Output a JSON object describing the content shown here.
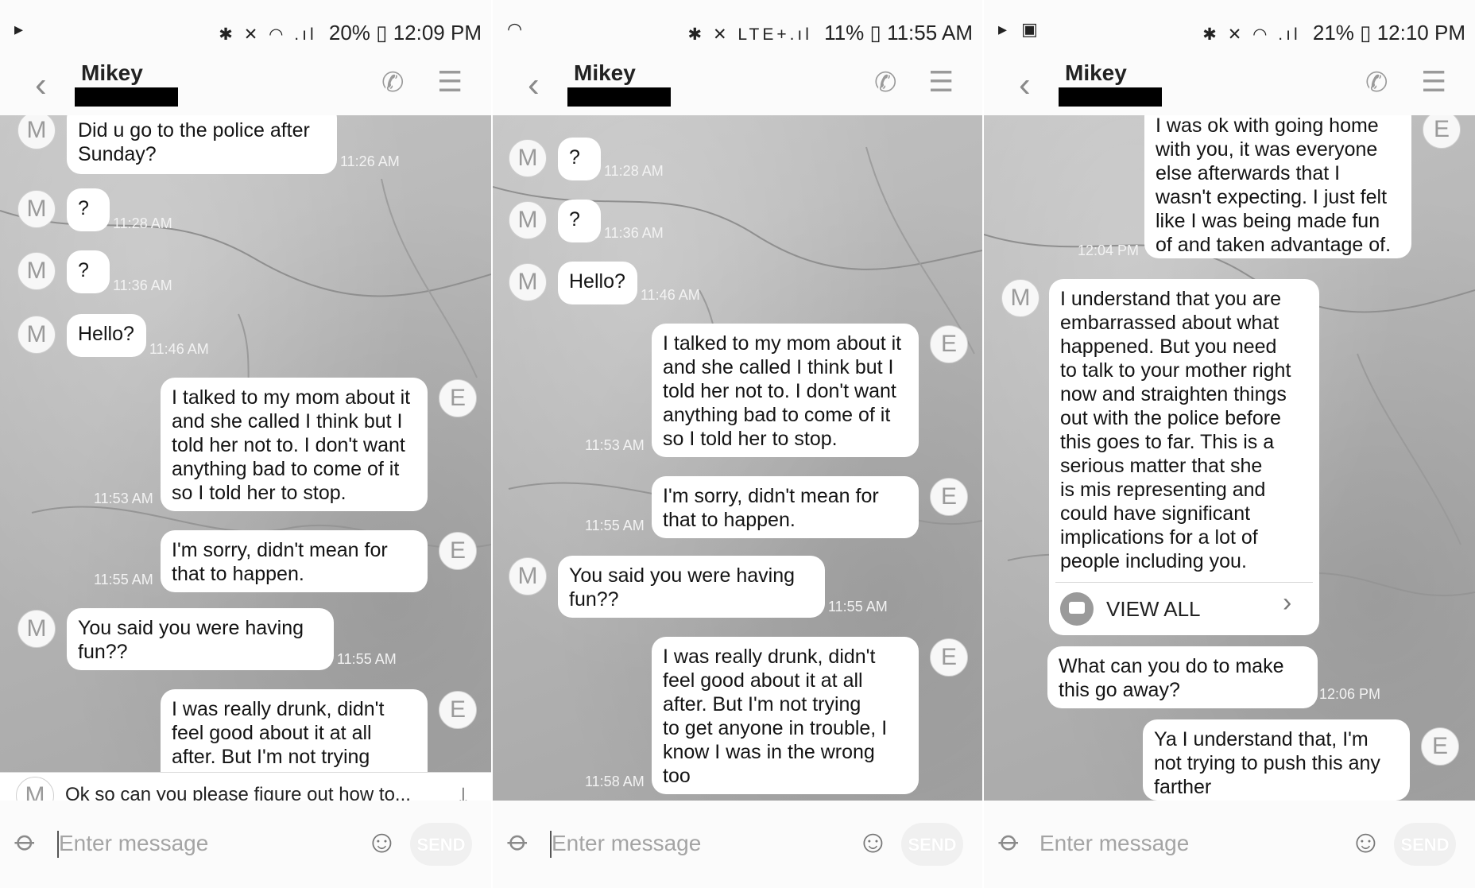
{
  "screens": [
    {
      "status": {
        "left_icons": "▸",
        "right_icons": "✱ ✕ ◠ .ıl",
        "battery": "20%",
        "time": "12:09 PM"
      },
      "contact": "Mikey",
      "messages": [
        {
          "from": "M",
          "text": "Did u go to the police after\nSunday?",
          "time": "11:26 AM"
        },
        {
          "from": "M",
          "text": "?",
          "time": "11:28 AM"
        },
        {
          "from": "M",
          "text": "?",
          "time": "11:36 AM"
        },
        {
          "from": "M",
          "text": "Hello?",
          "time": "11:46 AM"
        },
        {
          "from": "E",
          "text": "I talked to my mom about it\nand she called I think but I\ntold her not to. I don't want\nanything bad to come of it\nso I told her to stop.",
          "time": "11:53 AM"
        },
        {
          "from": "E",
          "text": "I'm sorry, didn't mean for\nthat to happen.",
          "time": "11:55 AM"
        },
        {
          "from": "M",
          "text": "You said you were having\nfun??",
          "time": "11:55 AM"
        },
        {
          "from": "E",
          "text": "I was really drunk, didn't\nfeel good about it at all\nafter. But I'm not trying",
          "time": ""
        }
      ],
      "preview": {
        "avatar": "M",
        "text": "Ok so can you please figure out  how to..."
      },
      "input_placeholder": "Enter message",
      "send_label": "SEND"
    },
    {
      "status": {
        "left_icons": "◠",
        "right_icons": "✱ ✕ LTE+.ıl",
        "battery": "11%",
        "time": "11:55 AM"
      },
      "contact": "Mikey",
      "messages": [
        {
          "from": "M",
          "text": "?",
          "time": "11:28 AM"
        },
        {
          "from": "M",
          "text": "?",
          "time": "11:36 AM"
        },
        {
          "from": "M",
          "text": "Hello?",
          "time": "11:46 AM"
        },
        {
          "from": "E",
          "text": "I talked to my mom about it\nand she called I think but I\ntold her not to. I don't want\nanything bad to come of it\nso I told her to stop.",
          "time": "11:53 AM"
        },
        {
          "from": "E",
          "text": "I'm sorry, didn't mean for\nthat to happen.",
          "time": "11:55 AM"
        },
        {
          "from": "M",
          "text": "You said you were having\nfun??",
          "time": "11:55 AM"
        },
        {
          "from": "E",
          "text": "I was really drunk, didn't\nfeel good about it at all\nafter. But I'm not trying\nto get anyone in trouble, I\nknow I was in the wrong\ntoo",
          "time": "11:58 AM"
        }
      ],
      "input_placeholder": "Enter message",
      "send_label": "SEND"
    },
    {
      "status": {
        "left_icons": "▸ ▣",
        "right_icons": "✱ ✕ ◠ .ıl",
        "battery": "21%",
        "time": "12:10 PM"
      },
      "contact": "Mikey",
      "messages": [
        {
          "from": "E",
          "text": "I was ok with going home\nwith you, it was everyone\nelse afterwards that I\nwasn't expecting. I just felt\nlike I was being made fun\nof and taken advantage of.",
          "time": "12:04 PM"
        },
        {
          "from": "M",
          "text": "I understand that you are\nembarrassed about what\nhappened. But you need\nto talk to your mother right\nnow and straighten things\nout with the police before\nthis goes to far. This is a\nserious matter that she\nis mis representing and\ncould have significant\nimplications for a lot of\npeople including you.",
          "time": "",
          "view_all": "VIEW ALL"
        },
        {
          "from": "M",
          "text": "What can you do to make\nthis go away?",
          "time": "12:06 PM"
        },
        {
          "from": "E",
          "text": "Ya I understand that, I'm\nnot trying to push this any\nfarther",
          "time": ""
        }
      ],
      "input_placeholder": "Enter message",
      "send_label": "SEND"
    }
  ]
}
